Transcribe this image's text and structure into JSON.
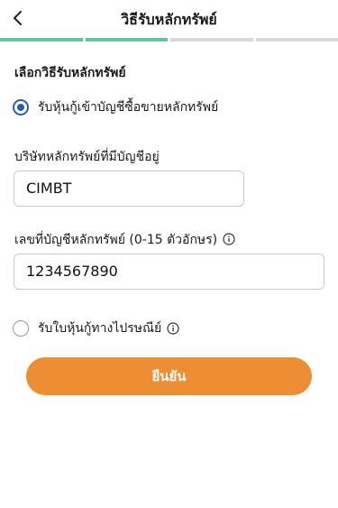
{
  "header": {
    "back_icon": "chevron-left-icon",
    "title": "วิธีรับหลักทรัพย์"
  },
  "progress": {
    "steps": 4,
    "completed": 2,
    "colors": {
      "done": "#63c3a6",
      "pending": "#d8d8d8"
    }
  },
  "section_title": "เลือกวิธีรับหลักทรัพย์",
  "option_account": {
    "label": "รับหุ้นกู้เข้าบัญชีซื้อขายหลักทรัพย์",
    "selected": true
  },
  "broker": {
    "label": "บริษัทหลักทรัพย์ที่มีบัญชีอยู่",
    "value": "CIMBT"
  },
  "account_no": {
    "label": "เลขที่บัญชีหลักทรัพย์ (0-15 ตัวอักษร)",
    "value": "1234567890",
    "info_icon": "info-icon"
  },
  "option_mail": {
    "label": "รับใบหุ้นกู้ทางไปรษณีย์",
    "selected": false,
    "info_icon": "info-icon"
  },
  "confirm_button": {
    "label": "ยืนยัน",
    "color": "#ee8e34"
  },
  "accent_color": "#2a5db0"
}
